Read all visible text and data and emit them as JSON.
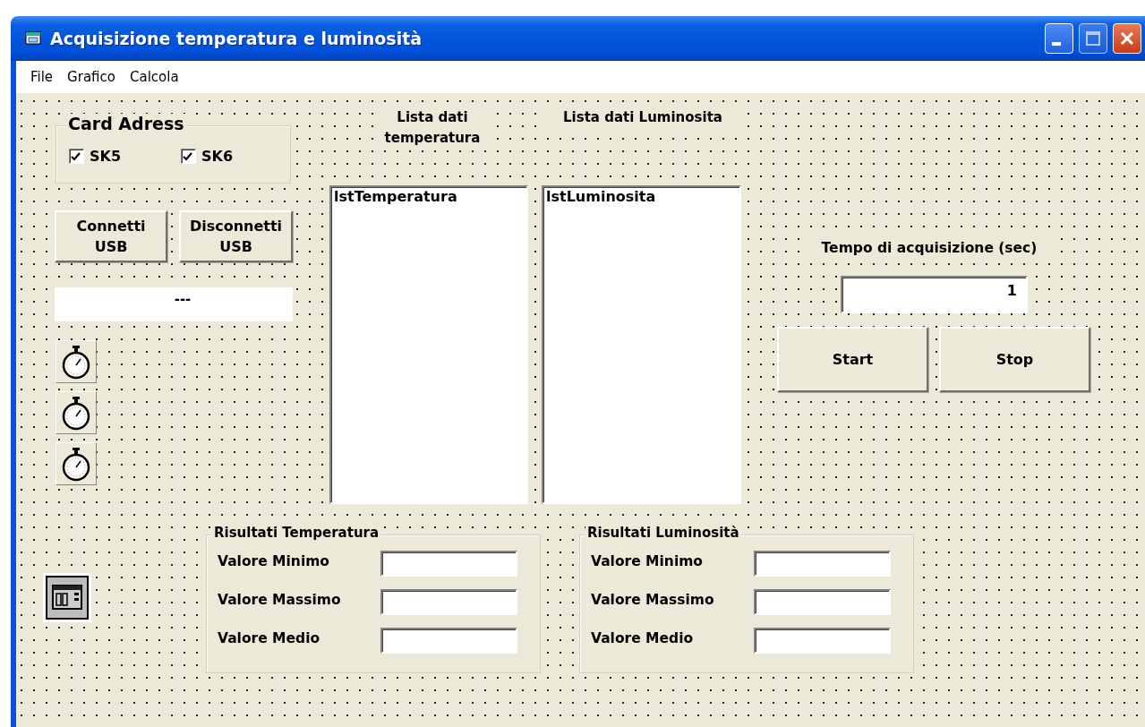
{
  "window": {
    "title": "Acquisizione temperatura e luminosità"
  },
  "menu": [
    "File",
    "Grafico",
    "Calcola"
  ],
  "card_frame": {
    "title": "Card Adress",
    "checkboxes": [
      {
        "label": "SK5",
        "checked": true
      },
      {
        "label": "SK6",
        "checked": true
      }
    ]
  },
  "usb_buttons": [
    "Connetti USB",
    "Disconnetti USB"
  ],
  "status_label": "---",
  "lists": [
    {
      "heading": "Lista dati temperatura",
      "item": "lstTemperatura"
    },
    {
      "heading": "Lista dati Luminosita",
      "item": "lstLuminosita"
    }
  ],
  "acquisition": {
    "label": "Tempo di acquisizione (sec)",
    "value": "1"
  },
  "control_buttons": [
    "Start",
    "Stop"
  ],
  "results": [
    {
      "title": "Risultati Temperatura",
      "rows": [
        "Valore Minimo",
        "Valore Massimo",
        "Valore Medio"
      ]
    },
    {
      "title": "Risultati Luminosità",
      "rows": [
        "Valore Minimo",
        "Valore Massimo",
        "Valore Medio"
      ]
    }
  ]
}
